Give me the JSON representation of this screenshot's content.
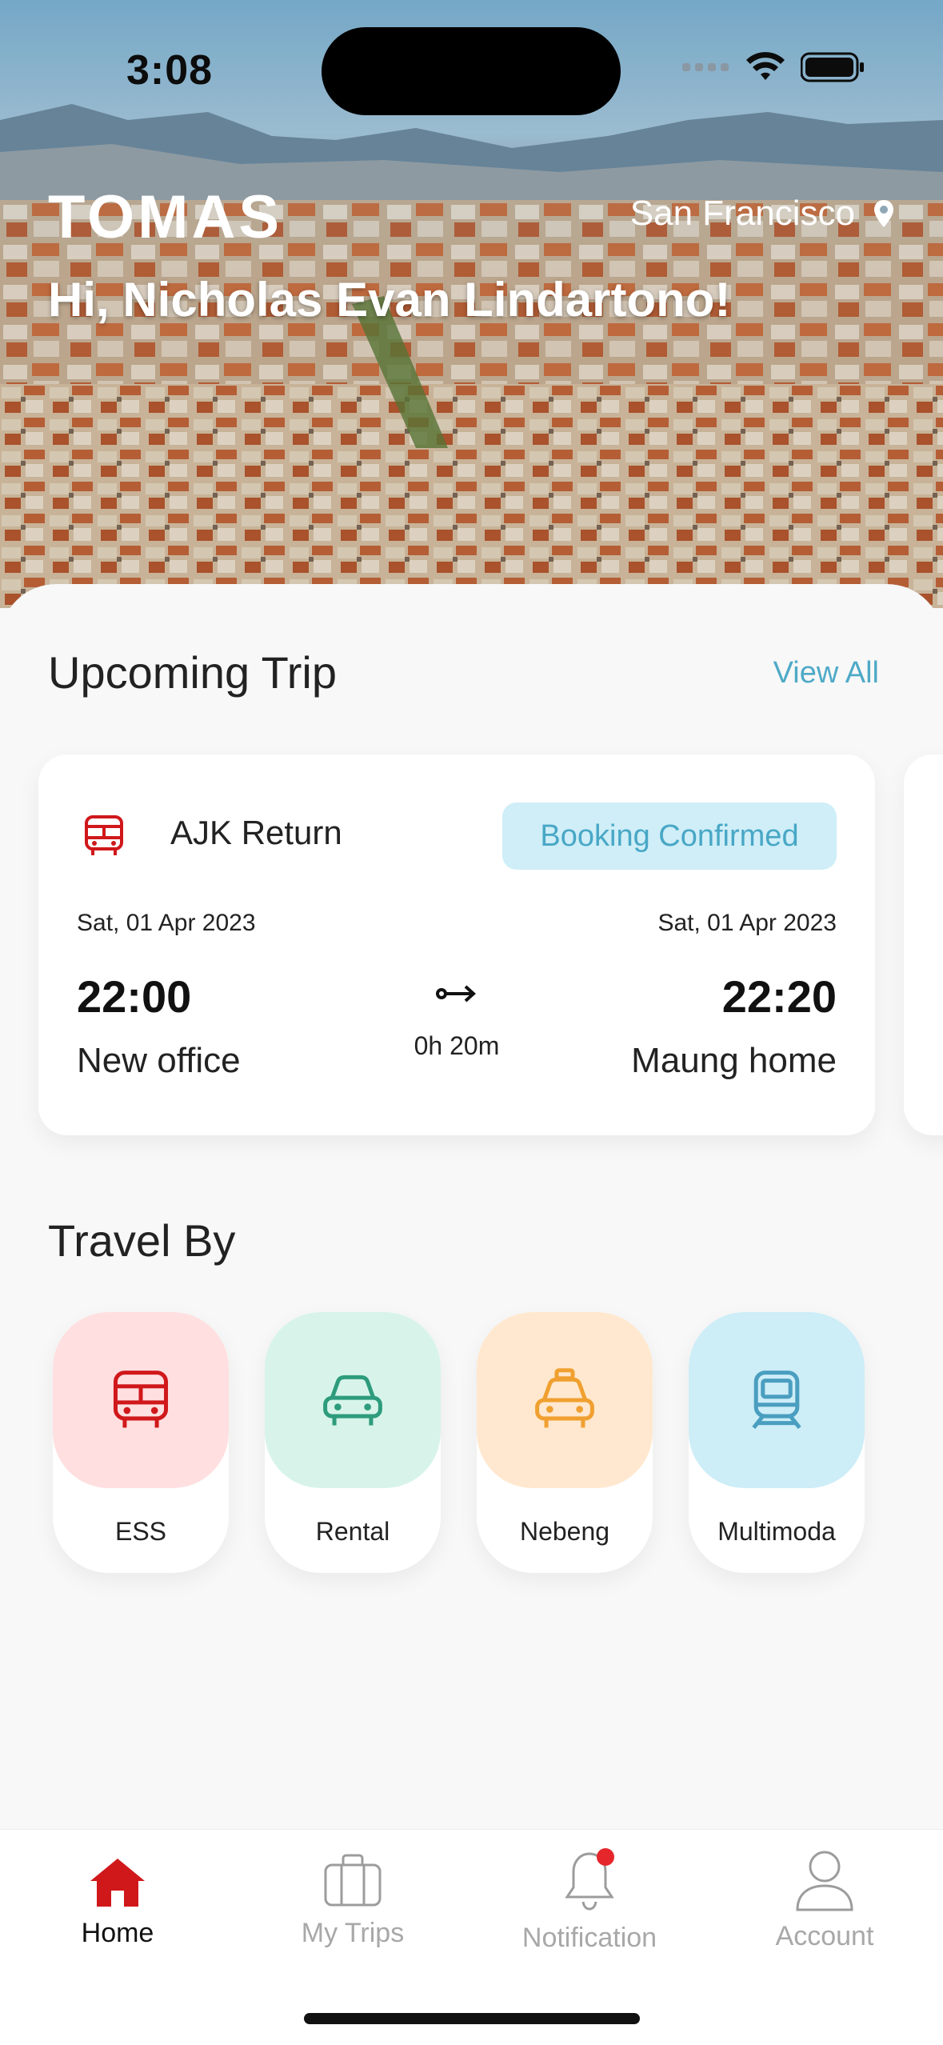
{
  "status_bar": {
    "time": "3:08"
  },
  "header": {
    "brand": "TOMAS",
    "location": "San Francisco",
    "greeting": "Hi, Nicholas Evan Lindartono!"
  },
  "upcoming": {
    "title": "Upcoming Trip",
    "view_all": "View All",
    "trip": {
      "name": "AJK Return",
      "status": "Booking Confirmed",
      "depart_date": "Sat, 01 Apr 2023",
      "arrive_date": "Sat, 01 Apr 2023",
      "depart_time": "22:00",
      "arrive_time": "22:20",
      "origin": "New office",
      "destination": "Maung home",
      "duration": "0h 20m"
    }
  },
  "travel_by": {
    "title": "Travel By",
    "options": [
      {
        "label": "ESS",
        "icon": "bus-icon",
        "bg": "#ffdfe0",
        "color": "#d0181b"
      },
      {
        "label": "Rental",
        "icon": "car-icon",
        "bg": "#d8f4ea",
        "color": "#2e9c7c"
      },
      {
        "label": "Nebeng",
        "icon": "taxi-icon",
        "bg": "#ffe8cf",
        "color": "#f0a030"
      },
      {
        "label": "Multimoda",
        "icon": "train-icon",
        "bg": "#cdedf7",
        "color": "#4a9ec0"
      }
    ]
  },
  "tabbar": {
    "tabs": [
      {
        "label": "Home",
        "icon": "home-icon"
      },
      {
        "label": "My Trips",
        "icon": "briefcase-icon"
      },
      {
        "label": "Notification",
        "icon": "bell-icon"
      },
      {
        "label": "Account",
        "icon": "user-icon"
      }
    ],
    "active": "Home"
  },
  "colors": {
    "accent": "#d0181b",
    "link": "#4eaac7",
    "badge_bg": "#cfeef7"
  }
}
